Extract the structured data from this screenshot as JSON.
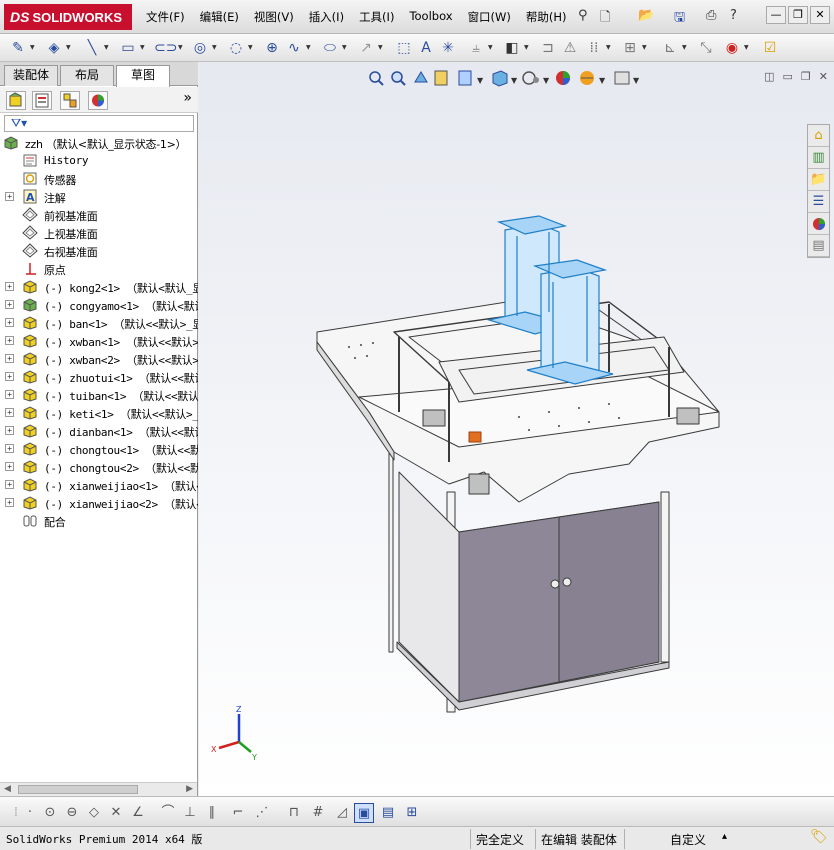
{
  "app": {
    "logo_text": "SOLIDWORKS",
    "logo_mark": "DS"
  },
  "menus": [
    "文件(F)",
    "编辑(E)",
    "视图(V)",
    "插入(I)",
    "工具(I)",
    "Toolbox",
    "窗口(W)",
    "帮助(H)"
  ],
  "fm": {
    "tabs": [
      "装配体",
      "布局",
      "草图"
    ],
    "active_tab": "草图",
    "expand_glyph": "»",
    "root": "zzh （默认<默认_显示状态-1>）",
    "items": [
      {
        "label": "History",
        "icon": "history-icon",
        "expand": false
      },
      {
        "label": "传感器",
        "icon": "sensor-icon",
        "expand": false
      },
      {
        "label": "注解",
        "icon": "annotation-icon",
        "expand": true
      },
      {
        "label": "前视基准面",
        "icon": "plane-icon",
        "expand": false
      },
      {
        "label": "上视基准面",
        "icon": "plane-icon",
        "expand": false
      },
      {
        "label": "右视基准面",
        "icon": "plane-icon",
        "expand": false
      },
      {
        "label": "原点",
        "icon": "origin-icon",
        "expand": false
      },
      {
        "label": "(-) kong2<1> （默认<默认_显",
        "icon": "component-icon",
        "expand": true
      },
      {
        "label": "(-) congyamo<1> （默认<默认",
        "icon": "component-icon-green",
        "expand": true
      },
      {
        "label": "(-) ban<1> （默认<<默认>_显",
        "icon": "component-icon",
        "expand": true
      },
      {
        "label": "(-) xwban<1> （默认<<默认>",
        "icon": "component-icon",
        "expand": true
      },
      {
        "label": "(-) xwban<2> （默认<<默认>",
        "icon": "component-icon",
        "expand": true
      },
      {
        "label": "(-) zhuotui<1> （默认<<默认",
        "icon": "component-icon",
        "expand": true
      },
      {
        "label": "(-) tuiban<1> （默认<<默认",
        "icon": "component-icon",
        "expand": true
      },
      {
        "label": "(-) keti<1> （默认<<默认>_",
        "icon": "component-icon",
        "expand": true
      },
      {
        "label": "(-) dianban<1> （默认<<默认",
        "icon": "component-icon",
        "expand": true
      },
      {
        "label": "(-) chongtou<1> （默认<<默",
        "icon": "component-icon",
        "expand": true
      },
      {
        "label": "(-) chongtou<2> （默认<<默",
        "icon": "component-icon",
        "expand": true
      },
      {
        "label": "(-) xianweijiao<1> （默认<",
        "icon": "component-icon",
        "expand": true
      },
      {
        "label": "(-) xianweijiao<2> （默认<",
        "icon": "component-icon",
        "expand": true
      },
      {
        "label": "配合",
        "icon": "mates-icon",
        "expand": false
      }
    ]
  },
  "triad": {
    "x": "X",
    "y": "Y",
    "z": "Z"
  },
  "status": {
    "product": "SolidWorks Premium 2014 x64 版",
    "definition": "完全定义",
    "editing": "在编辑 装配体",
    "units": "自定义",
    "units_arrow": "▴"
  },
  "colors": {
    "accent": "#c8102e",
    "highlight": "#4aa8e8",
    "cabinet": "#8a8494"
  }
}
